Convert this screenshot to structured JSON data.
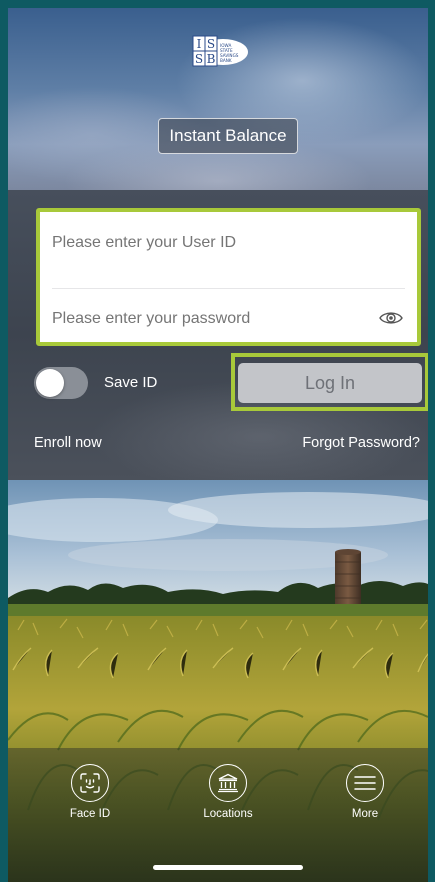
{
  "header": {
    "logo_text": "ISSB IOWA STATE SAVINGS BANK",
    "instant_balance_label": "Instant Balance"
  },
  "login": {
    "user_id_placeholder": "Please enter your User ID",
    "password_placeholder": "Please enter your password",
    "save_id_label": "Save ID",
    "save_id_enabled": false,
    "login_button_label": "Log In",
    "enroll_label": "Enroll now",
    "forgot_password_label": "Forgot Password?"
  },
  "tabbar": {
    "face_id_label": "Face ID",
    "locations_label": "Locations",
    "more_label": "More"
  },
  "colors": {
    "highlight": "#a8c93a",
    "band": "#3d444f"
  },
  "icons": {
    "face_id": "face-id-icon",
    "locations": "bank-icon",
    "more": "menu-icon",
    "show_password": "eye-icon"
  }
}
